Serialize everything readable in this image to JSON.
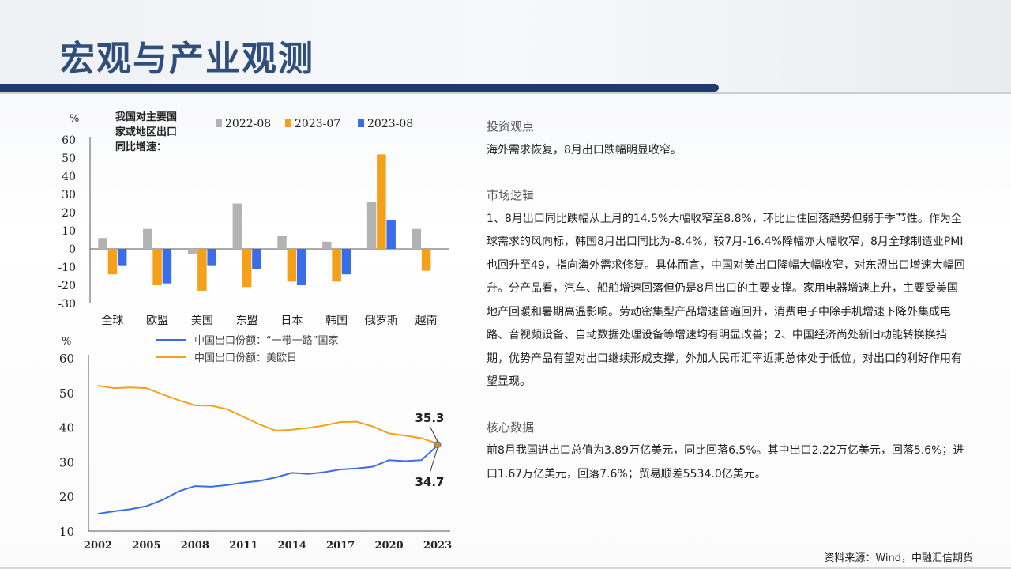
{
  "page": {
    "title": "宏观与产业观测",
    "source": "资料来源：Wind，中融汇信期货"
  },
  "text": {
    "view_title": "投资观点",
    "view_body": "海外需求恢复，8月出口跌幅明显收窄。",
    "logic_title": "市场逻辑",
    "logic_body": "1、8月出口同比跌幅从上月的14.5%大幅收窄至8.8%，环比止住回落趋势但弱于季节性。作为全球需求的风向标，韩国8月出口同比为-8.4%，较7月-16.4%降幅亦大幅收窄，8月全球制造业PMI也回升至49，指向海外需求修复。具体而言，中国对美出口降幅大幅收窄，对东盟出口增速大幅回升。分产品看，汽车、船舶增速回落但仍是8月出口的主要支撑。家用电器增速上升，主要受美国地产回暖和暑期高温影响。劳动密集型产品增速普遍回升，消费电子中除手机增速下降外集成电路、音视频设备、自动数据处理设备等增速均有明显改善；2、中国经济尚处新旧动能转换换挡期，优势产品有望对出口继续形成支撑，外加人民币汇率近期总体处于低位，对出口的利好作用有望显现。",
    "data_title": "核心数据",
    "data_body": "前8月我国进出口总值为3.89万亿美元，同比回落6.5%。其中出口2.22万亿美元，回落5.6%；进口1.67万亿美元，回落7.6%；贸易顺差5534.0亿美元。"
  },
  "colors": {
    "series_2022_08": "#b3b3b3",
    "series_2023_07": "#f5a01a",
    "series_2023_08": "#3a6ee8",
    "line_belt_road": "#3a6ee8",
    "line_us_eu_jp": "#f5a01a",
    "title_color": "#2f4f7a",
    "header_bar": "#1f3b6e"
  },
  "chart_data": [
    {
      "type": "bar",
      "title": "我国对主要国家或地区出口同比增速：",
      "ylabel": "%",
      "ylim": [
        -30,
        60
      ],
      "yticks": [
        60,
        50,
        40,
        30,
        20,
        10,
        0,
        -10,
        -20,
        -30
      ],
      "grid": false,
      "legend_position": "top",
      "categories": [
        "全球",
        "欧盟",
        "美国",
        "东盟",
        "日本",
        "韩国",
        "俄罗斯",
        "越南"
      ],
      "series": [
        {
          "name": "2022-08",
          "values": [
            6,
            11,
            -3,
            25,
            7,
            4,
            26,
            11
          ]
        },
        {
          "name": "2023-07",
          "values": [
            -14,
            -20,
            -23,
            -21,
            -18,
            -18,
            52,
            -12
          ]
        },
        {
          "name": "2023-08",
          "values": [
            -9,
            -19,
            -9,
            -11,
            -20,
            -14,
            16,
            null
          ]
        }
      ]
    },
    {
      "type": "line",
      "ylabel": "%",
      "ylim": [
        10,
        60
      ],
      "yticks": [
        60,
        50,
        40,
        30,
        20,
        10
      ],
      "xticks": [
        "2002",
        "2005",
        "2008",
        "2011",
        "2014",
        "2017",
        "2020",
        "2023"
      ],
      "grid": false,
      "legend_position": "top",
      "x": [
        2002,
        2003,
        2004,
        2005,
        2006,
        2007,
        2008,
        2009,
        2010,
        2011,
        2012,
        2013,
        2014,
        2015,
        2016,
        2017,
        2018,
        2019,
        2020,
        2021,
        2022,
        2023
      ],
      "series": [
        {
          "name": "中国出口份额：“一带一路”国家",
          "values": [
            15,
            15.7,
            16.3,
            17.2,
            19,
            21.5,
            23,
            22.8,
            23.3,
            24,
            24.5,
            25.5,
            26.8,
            26.5,
            27,
            27.8,
            28.1,
            28.6,
            30.5,
            30.2,
            30.5,
            34.7
          ]
        },
        {
          "name": "中国出口份额：美欧日",
          "values": [
            52,
            51.3,
            51.5,
            51.3,
            49.5,
            47.8,
            46.3,
            46.2,
            45.2,
            43,
            40.8,
            39,
            39.3,
            39.8,
            40.5,
            41.5,
            41.6,
            40.2,
            38.2,
            37.6,
            36.8,
            35.3
          ]
        }
      ],
      "annotations": [
        {
          "label": "35.3",
          "x": 2023,
          "series": "中国出口份额：美欧日"
        },
        {
          "label": "34.7",
          "x": 2023,
          "series": "中国出口份额：“一带一路”国家"
        }
      ]
    }
  ]
}
